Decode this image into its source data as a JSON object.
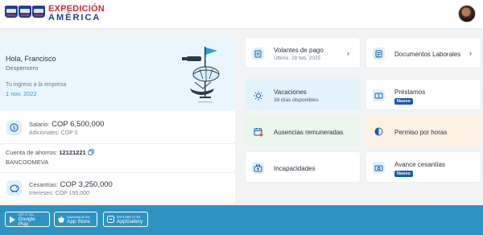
{
  "brand": {
    "line1": "EXPEDICIÓN",
    "line2": "AMÉRICA",
    "color_red": "#d42a2a",
    "color_blue": "#1f3f8f"
  },
  "greeting": {
    "name": "Hola, Francisco",
    "role": "Despensero",
    "entry_label": "Tu ingreso a la empresa",
    "entry_date": "1 nov. 2022"
  },
  "salary": {
    "label": "Salario:",
    "value": "COP 6,500,000",
    "sub": "Adicionales: COP 0",
    "icon": "dollar-icon"
  },
  "bank": {
    "label": "Cuenta de ahorros:",
    "number": "12121221",
    "bank": "BANCOOMEVA",
    "icon": "copy-icon"
  },
  "cesantias": {
    "label": "Cesantías:",
    "value": "COP 3,250,000",
    "sub": "Intereses: COP 195,000",
    "icon": "piggy-bank-icon"
  },
  "tiles": {
    "volantes": {
      "label": "Volantes de pago",
      "sub": "Último: 28 feb. 2025",
      "icon": "receipt-icon"
    },
    "documentos": {
      "label": "Documentos Laborales",
      "icon": "document-icon"
    },
    "vacaciones": {
      "label": "Vacaciones",
      "sub": "39 días disponibles",
      "icon": "sun-icon",
      "bg": "#e3f3fc"
    },
    "prestamos": {
      "label": "Préstamos",
      "badge": "Nuevo",
      "icon": "money-icon"
    },
    "ausencias": {
      "label": "Ausencias remuneradas",
      "icon": "calendar-icon",
      "bg": "#eaf5ec"
    },
    "permiso": {
      "label": "Permiso por horas",
      "icon": "clock-icon",
      "bg": "#fdf1e4"
    },
    "incapacidades": {
      "label": "Incapacidades",
      "icon": "medical-kit-icon"
    },
    "avance": {
      "label": "Avance cesantías",
      "badge": "Nuevo",
      "icon": "cash-icon"
    }
  },
  "footer": {
    "google": {
      "small": "GET IT ON",
      "big": "Google Play"
    },
    "apple": {
      "small": "Download on the",
      "big": "App Store"
    },
    "huawei": {
      "small": "EXPLORE IT ON",
      "big": "AppGallery"
    },
    "bg": "#2f93c2"
  }
}
